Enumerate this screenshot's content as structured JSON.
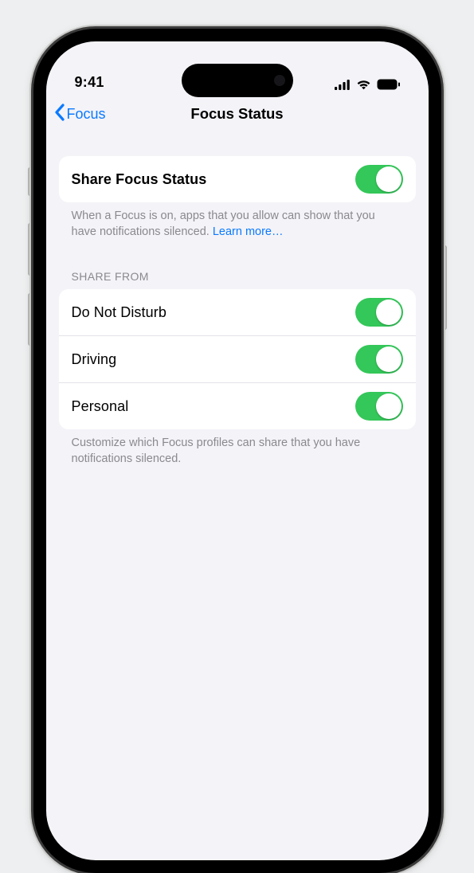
{
  "statusbar": {
    "time": "9:41"
  },
  "nav": {
    "back_label": "Focus",
    "title": "Focus Status"
  },
  "main_toggle": {
    "label": "Share Focus Status"
  },
  "main_footer_prefix": "When a Focus is on, apps that you allow can show that you have notifications silenced. ",
  "main_footer_link": "Learn more…",
  "share_section": {
    "header": "SHARE FROM"
  },
  "share_items": [
    {
      "label": "Do Not Disturb"
    },
    {
      "label": "Driving"
    },
    {
      "label": "Personal"
    }
  ],
  "share_footer": "Customize which Focus profiles can share that you have notifications silenced."
}
